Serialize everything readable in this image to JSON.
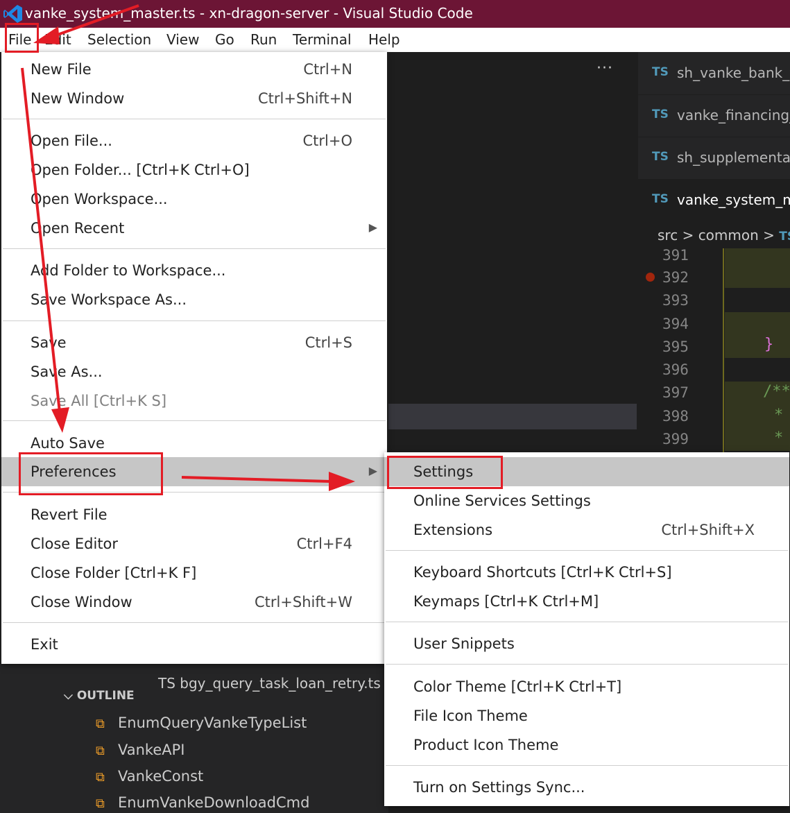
{
  "window": {
    "title": "vanke_system_master.ts - xn-dragon-server - Visual Studio Code"
  },
  "menubar": [
    "File",
    "Edit",
    "Selection",
    "View",
    "Go",
    "Run",
    "Terminal",
    "Help"
  ],
  "file_menu": {
    "groups": [
      [
        {
          "label": "New File",
          "shortcut": "Ctrl+N"
        },
        {
          "label": "New Window",
          "shortcut": "Ctrl+Shift+N"
        }
      ],
      [
        {
          "label": "Open File...",
          "shortcut": "Ctrl+O"
        },
        {
          "label": "Open Folder... [Ctrl+K Ctrl+O]"
        },
        {
          "label": "Open Workspace..."
        },
        {
          "label": "Open Recent",
          "submenu": true
        }
      ],
      [
        {
          "label": "Add Folder to Workspace..."
        },
        {
          "label": "Save Workspace As..."
        }
      ],
      [
        {
          "label": "Save",
          "shortcut": "Ctrl+S"
        },
        {
          "label": "Save As..."
        },
        {
          "label": "Save All [Ctrl+K S]",
          "disabled": true
        }
      ],
      [
        {
          "label": "Auto Save"
        },
        {
          "label": "Preferences",
          "submenu": true,
          "highlighted": true
        }
      ],
      [
        {
          "label": "Revert File"
        },
        {
          "label": "Close Editor",
          "shortcut": "Ctrl+F4"
        },
        {
          "label": "Close Folder [Ctrl+K F]"
        },
        {
          "label": "Close Window",
          "shortcut": "Ctrl+Shift+W"
        }
      ],
      [
        {
          "label": "Exit"
        }
      ]
    ]
  },
  "preferences_menu": {
    "groups": [
      [
        {
          "label": "Settings",
          "highlighted": true
        },
        {
          "label": "Online Services Settings"
        },
        {
          "label": "Extensions",
          "shortcut": "Ctrl+Shift+X"
        }
      ],
      [
        {
          "label": "Keyboard Shortcuts [Ctrl+K Ctrl+S]"
        },
        {
          "label": "Keymaps [Ctrl+K Ctrl+M]"
        }
      ],
      [
        {
          "label": "User Snippets"
        }
      ],
      [
        {
          "label": "Color Theme [Ctrl+K Ctrl+T]"
        },
        {
          "label": "File Icon Theme"
        },
        {
          "label": "Product Icon Theme"
        }
      ],
      [
        {
          "label": "Turn on Settings Sync..."
        }
      ]
    ]
  },
  "editor": {
    "more_actions": "···",
    "tab_badge": "TS",
    "tabs": [
      {
        "name": "sh_vanke_bank_v"
      },
      {
        "name": "vanke_financing_"
      },
      {
        "name": "sh_supplementa"
      },
      {
        "name": "vanke_system_m",
        "active": true
      }
    ],
    "breadcrumb": {
      "parts": [
        "src",
        "common"
      ],
      "sep": ">",
      "file_badge": "TS"
    },
    "line_numbers": [
      "391",
      "392",
      "393",
      "394",
      "395",
      "396",
      "397",
      "398",
      "399"
    ],
    "code_fragments": {
      "brace": "}",
      "comment_start": "/**",
      "star1": "*",
      "star2": "*"
    }
  },
  "explorer": {
    "partial_file": "TS  bgy_query_task_loan_retry.ts",
    "outline_header": "OUTLINE",
    "outline_items": [
      "EnumQueryVankeTypeList",
      "VankeAPI",
      "VankeConst",
      "EnumVankeDownloadCmd"
    ],
    "symbol_icon": "enum-icon"
  },
  "colors": {
    "titlebar": "#6c1535",
    "annotation_red": "#e31c25",
    "ts_icon": "#519aba",
    "outline_symbol": "#ee9d28"
  }
}
